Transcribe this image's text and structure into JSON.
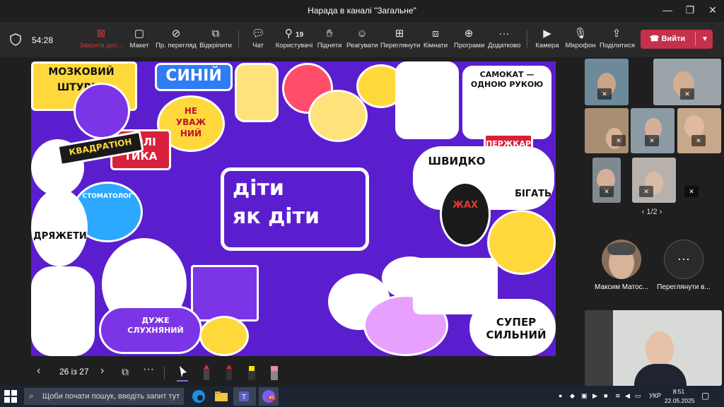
{
  "window": {
    "title": "Нарада в каналі \"Загальне\"",
    "minimize": "—",
    "restore": "❐",
    "close": "✕"
  },
  "toolbar": {
    "timer": "54:28",
    "close_share": "Закрити дос...",
    "layout": "Макет",
    "preview": "Пр. перегляд",
    "unpin": "Відкріпити",
    "chat": "Чат",
    "people": "Користувачі",
    "people_count": "19",
    "raise": "Підняти",
    "react": "Реагувати",
    "view": "Переглянути",
    "rooms": "Кімнати",
    "apps": "Програми",
    "more": "Додатково",
    "camera": "Камера",
    "mic": "Мікрофон",
    "share": "Поділитися",
    "leave": "Вийти"
  },
  "slide": {
    "center_line1": "діти",
    "center_line2": "як діти",
    "stickers": {
      "brainstorm": "МОЗКОВИЙ ШТУРМ!",
      "blue": "СИНІЙ",
      "inattentive": "НЕ УВАЖ НИЙ",
      "politics": "ПОЛІ ТИКА",
      "fast": "ШВИДКО",
      "run": "БІГАТЬ",
      "oneHand": "САМОКАТ — ОДНОЮ РУКОЮ",
      "strong": "СУПЕР СИЛЬНИЙ",
      "listening": "ДУЖЕ СЛУХНЯНИЙ",
      "perekar": "ПЕРЖКАР",
      "dentist": "СТОМАТОЛОГ",
      "quad": "КВАДРАТІОН",
      "sleep": "ДРЯЖЕТИ",
      "fear": "ЖАХ"
    },
    "page": "26 із 27"
  },
  "participants": {
    "pager": "1/2",
    "person_name": "Максим Матос...",
    "view_all": "Переглянути в..."
  },
  "taskbar": {
    "search": "Щоби почати пошук, введіть запит тут",
    "lang": "УКР",
    "time": "8:51",
    "date": "22.05.2025",
    "badge": "45"
  },
  "colors": {
    "purple": "#5b1ecf",
    "leave": "#c4314b",
    "toolbar": "#292929"
  }
}
